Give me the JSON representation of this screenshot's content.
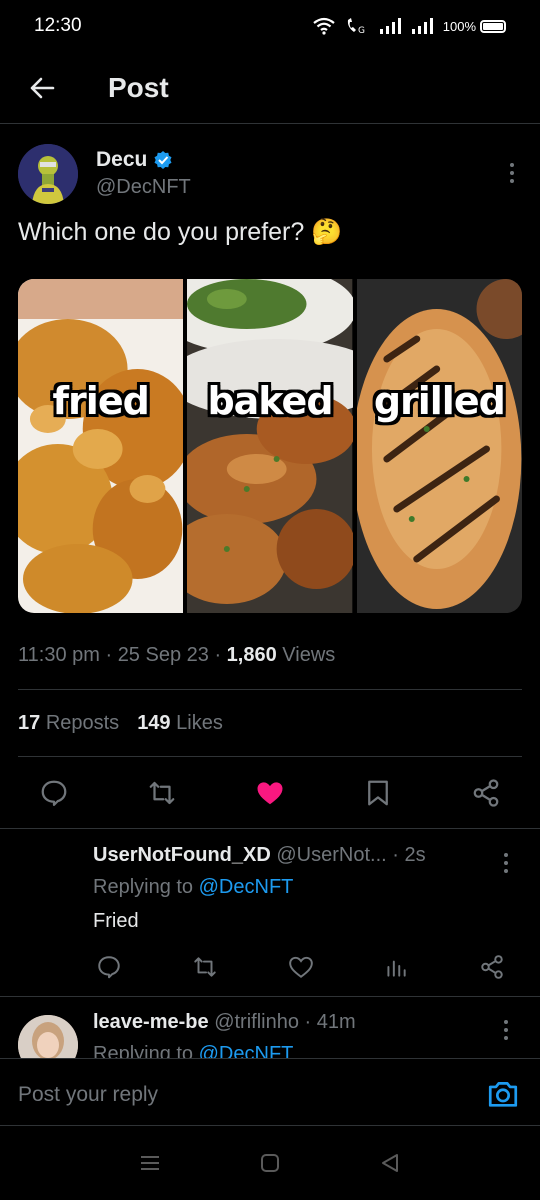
{
  "status_bar": {
    "time": "12:30",
    "battery": "100%"
  },
  "header": {
    "title": "Post"
  },
  "post": {
    "author_name": "Decu",
    "author_handle": "@DecNFT",
    "text": "Which one do you prefer? 🤔",
    "media_labels": [
      "fried",
      "baked",
      "grilled"
    ],
    "time": "11:30 pm",
    "date": "25 Sep 23",
    "views_count": "1,860",
    "views_label": "Views",
    "reposts_count": "17",
    "reposts_label": "Reposts",
    "likes_count": "149",
    "likes_label": "Likes",
    "liked": true,
    "like_color": "#f91880"
  },
  "replies": [
    {
      "name": "UserNotFound_XD",
      "handle": "@UserNot...",
      "time": "2s",
      "replying_prefix": "Replying to",
      "replying_to": "@DecNFT",
      "text": "Fried"
    },
    {
      "name": "leave-me-be",
      "handle": "@triflinho",
      "time": "41m",
      "replying_prefix": "Replying to",
      "replying_to": "@DecNFT"
    }
  ],
  "reply_bar": {
    "placeholder": "Post your reply"
  },
  "colors": {
    "background": "#000000",
    "accent": "#1d9bf0",
    "muted": "#71767b",
    "divider": "#2f3336"
  },
  "icons": {
    "back": "arrow-left-icon",
    "verified": "verified-badge-icon",
    "reply": "comment-icon",
    "repost": "repost-icon",
    "like": "heart-icon",
    "bookmark": "bookmark-icon",
    "share": "share-icon",
    "views": "analytics-icon",
    "camera": "camera-icon"
  }
}
